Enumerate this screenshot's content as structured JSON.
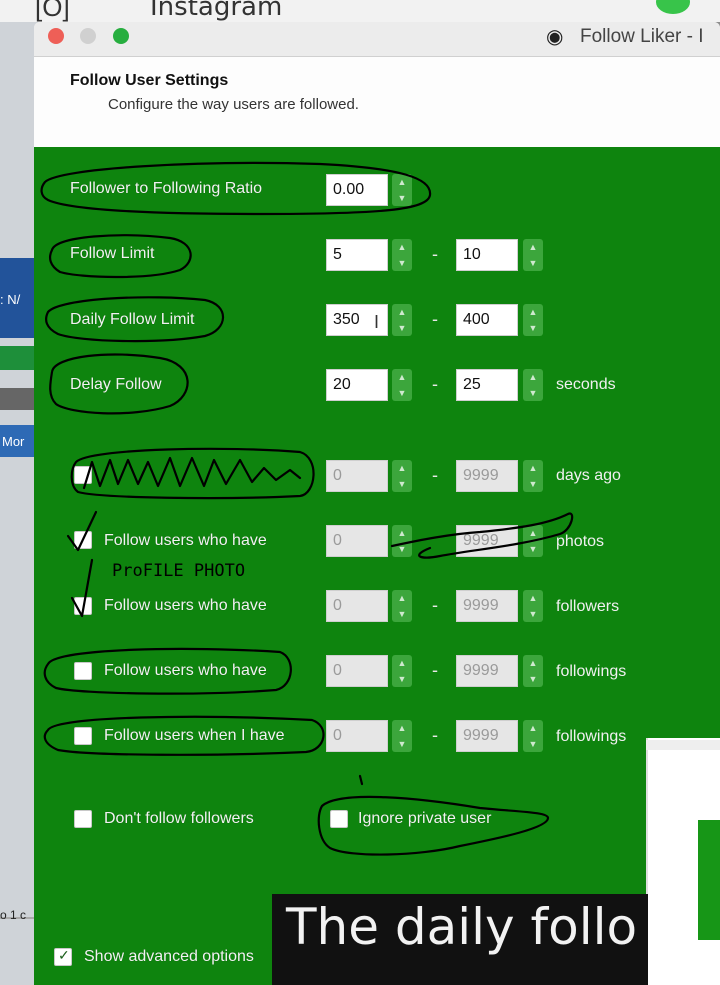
{
  "background": {
    "app_title": "Instagram",
    "left_label_1": ": N/",
    "left_label_2": "Mor",
    "left_label_3": "o 1 c"
  },
  "window": {
    "title": "Follow Liker - I",
    "header": {
      "title": "Follow User Settings",
      "subtitle": "Configure the way users are followed."
    }
  },
  "settings": {
    "ratio": {
      "label": "Follower to Following Ratio",
      "value": "0.00"
    },
    "follow_limit": {
      "label": "Follow Limit",
      "min": "5",
      "max": "10"
    },
    "daily_follow_limit": {
      "label": "Daily Follow Limit",
      "min": "350",
      "max": "400"
    },
    "delay_follow": {
      "label": "Delay Follow",
      "min": "20",
      "max": "25",
      "unit": "seconds"
    },
    "joined": {
      "min": "0",
      "max": "9999",
      "unit": "days ago"
    },
    "photos": {
      "label": "Follow users who have",
      "min": "0",
      "max": "9999",
      "unit": "photos"
    },
    "followers": {
      "label": "Follow users who have",
      "min": "0",
      "max": "9999",
      "unit": "followers"
    },
    "followings": {
      "label": "Follow users who have",
      "min": "0",
      "max": "9999",
      "unit": "followings"
    },
    "my_followings": {
      "label": "Follow users when I have",
      "min": "0",
      "max": "9999",
      "unit": "followings"
    },
    "dont_follow_followers": {
      "label": "Don't follow followers"
    },
    "ignore_private": {
      "label": "Ignore private user"
    },
    "show_advanced": {
      "label": "Show advanced options"
    }
  },
  "annotation": {
    "handwritten_note": "ProFILE PHOTO"
  },
  "subtitle_overlay": {
    "text": "The daily follo"
  },
  "colors": {
    "panel_green": "#0e840e",
    "stepper_green": "#3ca63c"
  }
}
